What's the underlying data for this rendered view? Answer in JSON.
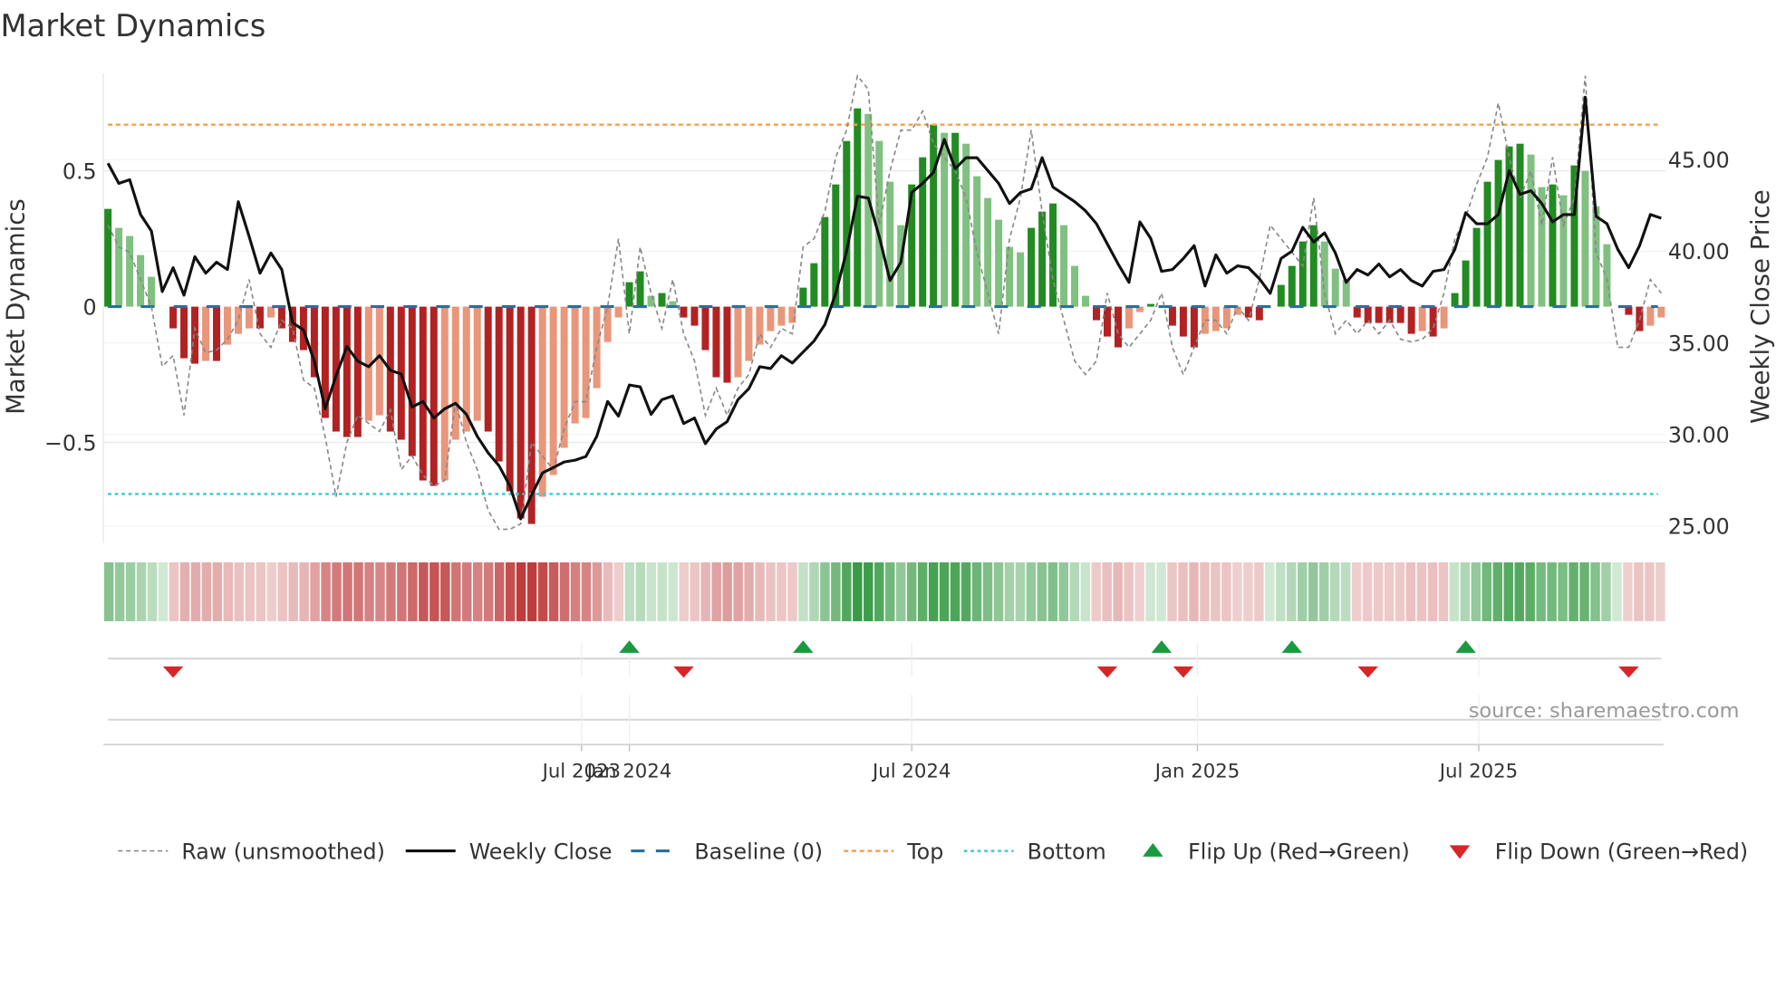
{
  "title": "Market Dynamics",
  "source": "source: sharemaestro.com",
  "colors": {
    "strong_up": "#228b22",
    "weak_up": "#80c080",
    "strong_down": "#b22222",
    "weak_down": "#e9967a",
    "price": "#111111",
    "raw": "#888888",
    "baseline": "#2a6f9e",
    "top": "#f0a050",
    "bottom": "#40c8d8",
    "flip_up": "#1a9a40",
    "flip_down": "#d62728"
  },
  "chart_data": {
    "type": "bar",
    "title": "Market Dynamics",
    "ylabel": "Market Dynamics",
    "y2label": "Weekly Close Price",
    "ylim": [
      -0.87,
      0.87
    ],
    "y2lim": [
      24,
      49.5
    ],
    "yticks": [
      {
        "v": 0.5,
        "label": "0.5"
      },
      {
        "v": 0,
        "label": "0"
      },
      {
        "v": -0.5,
        "label": "−0.5"
      }
    ],
    "y2ticks": [
      {
        "v": 45,
        "label": "45.00"
      },
      {
        "v": 40,
        "label": "40.00"
      },
      {
        "v": 35,
        "label": "35.00"
      },
      {
        "v": 30,
        "label": "30.00"
      },
      {
        "v": 25,
        "label": "25.00"
      }
    ],
    "xticks": [
      {
        "week": 43.6,
        "label": "Jul 2023"
      },
      {
        "week": 48.0,
        "label": "Jan 2024"
      },
      {
        "week": 74.0,
        "label": "Jul 2024"
      },
      {
        "week": 100.3,
        "label": "Jan 2025"
      },
      {
        "week": 126.2,
        "label": "Jul 2025"
      }
    ],
    "top_level": 0.67,
    "bottom_level": -0.69,
    "momentum": [
      0.36,
      0.29,
      0.26,
      0.19,
      0.11,
      0,
      -0.08,
      -0.19,
      -0.21,
      -0.2,
      -0.2,
      -0.14,
      -0.1,
      -0.08,
      -0.08,
      -0.04,
      -0.08,
      -0.13,
      -0.16,
      -0.26,
      -0.41,
      -0.46,
      -0.48,
      -0.48,
      -0.42,
      -0.4,
      -0.46,
      -0.49,
      -0.55,
      -0.64,
      -0.66,
      -0.64,
      -0.49,
      -0.46,
      -0.42,
      -0.46,
      -0.57,
      -0.68,
      -0.78,
      -0.8,
      -0.7,
      -0.62,
      -0.52,
      -0.43,
      -0.41,
      -0.3,
      -0.13,
      -0.04,
      0.09,
      0.13,
      0.04,
      0.05,
      0.02,
      -0.04,
      -0.07,
      -0.16,
      -0.26,
      -0.28,
      -0.26,
      -0.2,
      -0.14,
      -0.09,
      -0.07,
      -0.06,
      0.07,
      0.16,
      0.33,
      0.45,
      0.61,
      0.73,
      0.71,
      0.61,
      0.46,
      0.3,
      0.45,
      0.55,
      0.67,
      0.64,
      0.64,
      0.6,
      0.48,
      0.4,
      0.32,
      0.22,
      0.2,
      0.29,
      0.35,
      0.38,
      0.3,
      0.15,
      0.04,
      -0.05,
      -0.11,
      -0.15,
      -0.08,
      -0.02,
      0.01,
      0.0,
      -0.07,
      -0.11,
      -0.15,
      -0.1,
      -0.09,
      -0.08,
      -0.03,
      -0.04,
      -0.05,
      0.0,
      0.08,
      0.15,
      0.24,
      0.3,
      0.24,
      0.14,
      0.1,
      -0.04,
      -0.06,
      -0.06,
      -0.06,
      -0.06,
      -0.1,
      -0.09,
      -0.11,
      -0.08,
      0.05,
      0.17,
      0.29,
      0.46,
      0.54,
      0.59,
      0.6,
      0.56,
      0.44,
      0.45,
      0.41,
      0.52,
      0.5,
      0.37,
      0.23,
      0.0,
      -0.03,
      -0.09,
      -0.07,
      -0.04
    ],
    "raw": [
      0.3,
      0.22,
      0.2,
      0.1,
      0.0,
      -0.22,
      -0.18,
      -0.4,
      -0.08,
      -0.17,
      -0.16,
      -0.12,
      -0.05,
      0.1,
      -0.1,
      -0.15,
      -0.05,
      -0.08,
      -0.27,
      -0.3,
      -0.48,
      -0.7,
      -0.5,
      -0.4,
      -0.43,
      -0.46,
      -0.38,
      -0.6,
      -0.55,
      -0.62,
      -0.66,
      -0.64,
      -0.35,
      -0.5,
      -0.6,
      -0.75,
      -0.82,
      -0.82,
      -0.8,
      -0.5,
      -0.55,
      -0.6,
      -0.45,
      -0.35,
      -0.35,
      -0.15,
      0.0,
      0.25,
      -0.1,
      0.22,
      0.05,
      -0.08,
      0.1,
      -0.1,
      -0.2,
      -0.4,
      -0.3,
      -0.4,
      -0.3,
      -0.25,
      -0.1,
      -0.15,
      -0.08,
      -0.1,
      0.22,
      0.25,
      0.35,
      0.55,
      0.65,
      0.85,
      0.8,
      0.3,
      0.5,
      0.65,
      0.65,
      0.72,
      0.6,
      0.55,
      0.5,
      0.4,
      0.2,
      0.05,
      -0.1,
      0.25,
      0.4,
      0.65,
      0.35,
      0.1,
      -0.05,
      -0.2,
      -0.25,
      -0.2,
      0.05,
      -0.1,
      -0.15,
      -0.1,
      -0.05,
      0.05,
      -0.15,
      -0.25,
      -0.15,
      -0.05,
      -0.05,
      -0.1,
      0.0,
      -0.05,
      0.1,
      0.3,
      0.25,
      0.2,
      0.15,
      0.4,
      0.05,
      -0.1,
      -0.05,
      -0.1,
      -0.05,
      -0.1,
      -0.05,
      -0.12,
      -0.13,
      -0.12,
      -0.08,
      0.05,
      0.25,
      0.33,
      0.45,
      0.55,
      0.75,
      0.55,
      0.4,
      0.5,
      0.3,
      0.55,
      0.3,
      0.4,
      0.85,
      0.2,
      0.1,
      -0.15,
      -0.15,
      -0.05,
      0.1,
      0.05
    ],
    "weekly_close": [
      44.8,
      43.7,
      43.9,
      42.0,
      41.1,
      37.8,
      39.1,
      37.6,
      39.7,
      38.8,
      39.4,
      39.0,
      42.7,
      40.8,
      38.8,
      39.9,
      39.0,
      36.1,
      35.7,
      34.0,
      31.4,
      33.2,
      34.8,
      34.0,
      33.7,
      34.3,
      33.5,
      33.3,
      31.5,
      31.8,
      30.9,
      31.4,
      31.7,
      31.1,
      29.9,
      29.0,
      28.3,
      27.2,
      25.4,
      26.7,
      27.9,
      28.2,
      28.5,
      28.6,
      28.8,
      29.9,
      31.8,
      31.0,
      32.7,
      32.6,
      31.1,
      31.9,
      32.1,
      30.6,
      30.9,
      29.5,
      30.3,
      30.7,
      31.9,
      32.5,
      33.7,
      33.6,
      34.3,
      33.9,
      34.5,
      35.1,
      36.0,
      37.7,
      40.0,
      43.0,
      42.9,
      40.8,
      38.4,
      39.4,
      43.2,
      43.7,
      44.3,
      46.1,
      44.5,
      45.1,
      45.1,
      44.4,
      43.7,
      42.6,
      43.2,
      43.4,
      45.1,
      43.5,
      43.1,
      42.7,
      42.2,
      41.5,
      40.4,
      39.3,
      38.3,
      41.6,
      40.7,
      38.9,
      39.0,
      39.6,
      40.3,
      38.1,
      39.8,
      38.8,
      39.2,
      39.1,
      38.5,
      37.7,
      39.6,
      40.0,
      41.3,
      40.5,
      41.0,
      39.9,
      38.3,
      39.0,
      38.7,
      39.3,
      38.6,
      39.0,
      38.4,
      38.1,
      38.9,
      39.0,
      40.1,
      42.1,
      41.5,
      41.5,
      42.0,
      44.4,
      43.1,
      43.3,
      42.6,
      41.6,
      42.0,
      42.0,
      48.4,
      41.9,
      41.5,
      40.1,
      39.1,
      40.3,
      42.0,
      41.8
    ],
    "flip_up_weeks": [
      48,
      64,
      97,
      109,
      125
    ],
    "flip_down_weeks": [
      6,
      53,
      92,
      99,
      116,
      140
    ],
    "legend": [
      {
        "key": "raw",
        "label": "Raw (unsmoothed)"
      },
      {
        "key": "price",
        "label": "Weekly Close"
      },
      {
        "key": "baseline",
        "label": "Baseline (0)"
      },
      {
        "key": "top",
        "label": "Top"
      },
      {
        "key": "bottom",
        "label": "Bottom"
      },
      {
        "key": "flip_up",
        "label": "Flip Up (Red→Green)"
      },
      {
        "key": "flip_down",
        "label": "Flip Down (Green→Red)"
      }
    ],
    "legend_position": "bottom"
  }
}
